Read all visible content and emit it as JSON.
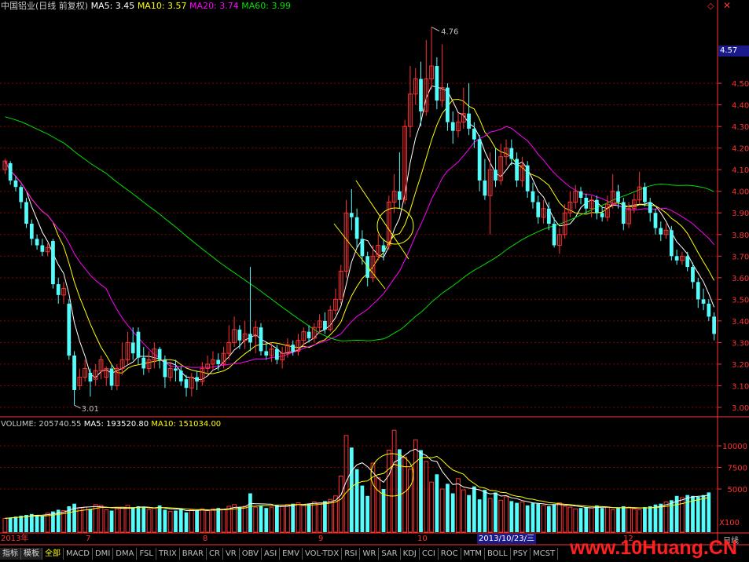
{
  "header": {
    "stock_name": "中国铝业(日线 前复权)",
    "ma5": "MA5: 3.45",
    "ma10": "MA10: 3.57",
    "ma20": "MA20: 3.74",
    "ma60": "MA60: 3.99"
  },
  "volume_header": {
    "volume": "VOLUME: 205740.55",
    "ma5": "MA5: 193520.80",
    "ma10": "MA10: 151034.00"
  },
  "colors": {
    "up": "#ff3232",
    "down": "#54fcfc",
    "ma5": "#ffffff",
    "ma10": "#ffff00",
    "ma20": "#ff00ff",
    "ma60": "#00e000",
    "axis": "#ff3232",
    "grid": "#8b0000"
  },
  "chart_data": {
    "type": "candlestick",
    "price_axis": {
      "ticks": [
        "4.50",
        "4.40",
        "4.30",
        "4.20",
        "4.10",
        "4.00",
        "3.90",
        "3.80",
        "3.70",
        "3.60",
        "3.50",
        "3.40",
        "3.30",
        "3.20",
        "3.10",
        "3.00"
      ],
      "ylim": [
        2.96,
        4.82
      ]
    },
    "current_price_label": "4.57",
    "annotations": {
      "high": "4.76",
      "low": "3.01"
    },
    "volume_axis": {
      "ticks": [
        "10000",
        "7500",
        "5000"
      ],
      "unit": "X100",
      "ylim": [
        0,
        13000
      ]
    },
    "x_labels": {
      "start": "2013年",
      "months": [
        "7",
        "8",
        "9",
        "10",
        "12"
      ],
      "cursor": "2013/10/23/三"
    },
    "candles": [
      {
        "o": 4.1,
        "c": 4.14,
        "h": 4.15,
        "l": 4.08
      },
      {
        "o": 4.13,
        "c": 4.05,
        "h": 4.14,
        "l": 4.03
      },
      {
        "o": 4.05,
        "c": 4.02,
        "h": 4.07,
        "l": 4.0
      },
      {
        "o": 4.02,
        "c": 3.95,
        "h": 4.03,
        "l": 3.92
      },
      {
        "o": 3.95,
        "c": 3.85,
        "h": 3.97,
        "l": 3.83
      },
      {
        "o": 3.85,
        "c": 3.78,
        "h": 3.87,
        "l": 3.75
      },
      {
        "o": 3.78,
        "c": 3.75,
        "h": 3.8,
        "l": 3.73
      },
      {
        "o": 3.75,
        "c": 3.72,
        "h": 3.78,
        "l": 3.7
      },
      {
        "o": 3.72,
        "c": 3.74,
        "h": 3.76,
        "l": 3.7
      },
      {
        "o": 3.77,
        "c": 3.57,
        "h": 3.78,
        "l": 3.55
      },
      {
        "o": 3.57,
        "c": 3.52,
        "h": 3.6,
        "l": 3.48
      },
      {
        "o": 3.52,
        "c": 3.55,
        "h": 3.58,
        "l": 3.48
      },
      {
        "o": 3.48,
        "c": 3.24,
        "h": 3.5,
        "l": 3.22
      },
      {
        "o": 3.24,
        "c": 3.08,
        "h": 3.26,
        "l": 3.01
      },
      {
        "o": 3.1,
        "c": 3.14,
        "h": 3.18,
        "l": 3.08
      },
      {
        "o": 3.14,
        "c": 3.18,
        "h": 3.22,
        "l": 3.12
      },
      {
        "o": 3.16,
        "c": 3.12,
        "h": 3.18,
        "l": 3.05
      },
      {
        "o": 3.13,
        "c": 3.17,
        "h": 3.2,
        "l": 3.1
      },
      {
        "o": 3.17,
        "c": 3.22,
        "h": 3.24,
        "l": 3.13
      },
      {
        "o": 3.14,
        "c": 3.18,
        "h": 3.19,
        "l": 3.1
      },
      {
        "o": 3.18,
        "c": 3.1,
        "h": 3.2,
        "l": 3.08
      },
      {
        "o": 3.1,
        "c": 3.18,
        "h": 3.2,
        "l": 3.08
      },
      {
        "o": 3.18,
        "c": 3.22,
        "h": 3.3,
        "l": 3.15
      },
      {
        "o": 3.22,
        "c": 3.3,
        "h": 3.35,
        "l": 3.2
      },
      {
        "o": 3.3,
        "c": 3.25,
        "h": 3.37,
        "l": 3.22
      },
      {
        "o": 3.35,
        "c": 3.23,
        "h": 3.37,
        "l": 3.2
      },
      {
        "o": 3.23,
        "c": 3.18,
        "h": 3.28,
        "l": 3.15
      },
      {
        "o": 3.18,
        "c": 3.22,
        "h": 3.26,
        "l": 3.16
      },
      {
        "o": 3.22,
        "c": 3.27,
        "h": 3.3,
        "l": 3.18
      },
      {
        "o": 3.27,
        "c": 3.22,
        "h": 3.28,
        "l": 3.18
      },
      {
        "o": 3.22,
        "c": 3.14,
        "h": 3.24,
        "l": 3.09
      },
      {
        "o": 3.14,
        "c": 3.18,
        "h": 3.21,
        "l": 3.12
      },
      {
        "o": 3.18,
        "c": 3.17,
        "h": 3.22,
        "l": 3.12
      },
      {
        "o": 3.17,
        "c": 3.12,
        "h": 3.19,
        "l": 3.1
      },
      {
        "o": 3.13,
        "c": 3.09,
        "h": 3.15,
        "l": 3.05
      },
      {
        "o": 3.09,
        "c": 3.14,
        "h": 3.16,
        "l": 3.05
      },
      {
        "o": 3.14,
        "c": 3.12,
        "h": 3.17,
        "l": 3.08
      },
      {
        "o": 3.12,
        "c": 3.18,
        "h": 3.21,
        "l": 3.1
      },
      {
        "o": 3.18,
        "c": 3.2,
        "h": 3.24,
        "l": 3.15
      },
      {
        "o": 3.2,
        "c": 3.22,
        "h": 3.26,
        "l": 3.17
      },
      {
        "o": 3.22,
        "c": 3.2,
        "h": 3.25,
        "l": 3.17
      },
      {
        "o": 3.2,
        "c": 3.25,
        "h": 3.28,
        "l": 3.18
      },
      {
        "o": 3.25,
        "c": 3.3,
        "h": 3.38,
        "l": 3.22
      },
      {
        "o": 3.3,
        "c": 3.36,
        "h": 3.42,
        "l": 3.28
      },
      {
        "o": 3.36,
        "c": 3.31,
        "h": 3.38,
        "l": 3.27
      },
      {
        "o": 3.31,
        "c": 3.34,
        "h": 3.4,
        "l": 3.27
      },
      {
        "o": 3.34,
        "c": 3.3,
        "h": 3.65,
        "l": 3.26
      },
      {
        "o": 3.33,
        "c": 3.37,
        "h": 3.4,
        "l": 3.25
      },
      {
        "o": 3.37,
        "c": 3.26,
        "h": 3.39,
        "l": 3.24
      },
      {
        "o": 3.26,
        "c": 3.24,
        "h": 3.3,
        "l": 3.22
      },
      {
        "o": 3.24,
        "c": 3.27,
        "h": 3.3,
        "l": 3.21
      },
      {
        "o": 3.27,
        "c": 3.22,
        "h": 3.29,
        "l": 3.2
      },
      {
        "o": 3.22,
        "c": 3.25,
        "h": 3.28,
        "l": 3.18
      },
      {
        "o": 3.25,
        "c": 3.29,
        "h": 3.32,
        "l": 3.23
      },
      {
        "o": 3.29,
        "c": 3.26,
        "h": 3.31,
        "l": 3.24
      },
      {
        "o": 3.26,
        "c": 3.31,
        "h": 3.34,
        "l": 3.24
      },
      {
        "o": 3.31,
        "c": 3.35,
        "h": 3.37,
        "l": 3.28
      },
      {
        "o": 3.35,
        "c": 3.32,
        "h": 3.38,
        "l": 3.3
      },
      {
        "o": 3.32,
        "c": 3.37,
        "h": 3.39,
        "l": 3.3
      },
      {
        "o": 3.37,
        "c": 3.4,
        "h": 3.43,
        "l": 3.34
      },
      {
        "o": 3.4,
        "c": 3.36,
        "h": 3.44,
        "l": 3.34
      },
      {
        "o": 3.36,
        "c": 3.45,
        "h": 3.47,
        "l": 3.35
      },
      {
        "o": 3.45,
        "c": 3.5,
        "h": 3.55,
        "l": 3.43
      },
      {
        "o": 3.5,
        "c": 3.63,
        "h": 3.66,
        "l": 3.48
      },
      {
        "o": 3.63,
        "c": 3.9,
        "h": 3.96,
        "l": 3.6
      },
      {
        "o": 3.9,
        "c": 3.88,
        "h": 4.01,
        "l": 3.82
      },
      {
        "o": 3.88,
        "c": 3.78,
        "h": 3.92,
        "l": 3.74
      },
      {
        "o": 3.78,
        "c": 3.7,
        "h": 3.82,
        "l": 3.66
      },
      {
        "o": 3.7,
        "c": 3.6,
        "h": 3.72,
        "l": 3.56
      },
      {
        "o": 3.6,
        "c": 3.7,
        "h": 3.75,
        "l": 3.58
      },
      {
        "o": 3.7,
        "c": 3.75,
        "h": 3.8,
        "l": 3.68
      },
      {
        "o": 3.75,
        "c": 3.72,
        "h": 3.78,
        "l": 3.68
      },
      {
        "o": 3.75,
        "c": 3.95,
        "h": 3.98,
        "l": 3.73
      },
      {
        "o": 3.95,
        "c": 4.0,
        "h": 4.08,
        "l": 3.9
      },
      {
        "o": 4.0,
        "c": 3.96,
        "h": 4.18,
        "l": 3.92
      },
      {
        "o": 3.96,
        "c": 4.3,
        "h": 4.33,
        "l": 3.94
      },
      {
        "o": 4.3,
        "c": 4.45,
        "h": 4.58,
        "l": 4.25
      },
      {
        "o": 4.45,
        "c": 4.52,
        "h": 4.57,
        "l": 4.4
      },
      {
        "o": 4.52,
        "c": 4.37,
        "h": 4.6,
        "l": 4.3
      },
      {
        "o": 4.37,
        "c": 4.52,
        "h": 4.7,
        "l": 4.35
      },
      {
        "o": 4.52,
        "c": 4.58,
        "h": 4.76,
        "l": 4.47
      },
      {
        "o": 4.58,
        "c": 4.42,
        "h": 4.62,
        "l": 4.38
      },
      {
        "o": 4.42,
        "c": 4.48,
        "h": 4.68,
        "l": 4.39
      },
      {
        "o": 4.48,
        "c": 4.32,
        "h": 4.5,
        "l": 4.28
      },
      {
        "o": 4.32,
        "c": 4.28,
        "h": 4.37,
        "l": 4.22
      },
      {
        "o": 4.28,
        "c": 4.32,
        "h": 4.36,
        "l": 4.25
      },
      {
        "o": 4.32,
        "c": 4.36,
        "h": 4.48,
        "l": 4.29
      },
      {
        "o": 4.36,
        "c": 4.29,
        "h": 4.5,
        "l": 4.26
      },
      {
        "o": 4.29,
        "c": 4.24,
        "h": 4.32,
        "l": 4.2
      },
      {
        "o": 4.24,
        "c": 4.05,
        "h": 4.26,
        "l": 4.0
      },
      {
        "o": 4.05,
        "c": 3.98,
        "h": 4.15,
        "l": 3.96
      },
      {
        "o": 3.98,
        "c": 4.1,
        "h": 4.18,
        "l": 3.8
      },
      {
        "o": 4.1,
        "c": 4.05,
        "h": 4.2,
        "l": 4.02
      },
      {
        "o": 4.05,
        "c": 4.16,
        "h": 4.22,
        "l": 4.03
      },
      {
        "o": 4.16,
        "c": 4.2,
        "h": 4.24,
        "l": 4.12
      },
      {
        "o": 4.2,
        "c": 4.15,
        "h": 4.24,
        "l": 4.12
      },
      {
        "o": 4.15,
        "c": 4.05,
        "h": 4.18,
        "l": 4.02
      },
      {
        "o": 4.05,
        "c": 4.12,
        "h": 4.16,
        "l": 4.02
      },
      {
        "o": 4.12,
        "c": 4.0,
        "h": 4.14,
        "l": 3.97
      },
      {
        "o": 4.0,
        "c": 3.95,
        "h": 4.04,
        "l": 3.92
      },
      {
        "o": 3.95,
        "c": 3.88,
        "h": 3.98,
        "l": 3.85
      },
      {
        "o": 3.88,
        "c": 3.92,
        "h": 3.96,
        "l": 3.85
      },
      {
        "o": 3.92,
        "c": 3.85,
        "h": 3.95,
        "l": 3.82
      },
      {
        "o": 3.85,
        "c": 3.75,
        "h": 3.88,
        "l": 3.74
      },
      {
        "o": 3.75,
        "c": 3.8,
        "h": 3.83,
        "l": 3.71
      },
      {
        "o": 3.8,
        "c": 3.9,
        "h": 3.94,
        "l": 3.78
      },
      {
        "o": 3.9,
        "c": 3.95,
        "h": 4.0,
        "l": 3.88
      },
      {
        "o": 3.95,
        "c": 4.0,
        "h": 4.03,
        "l": 3.92
      },
      {
        "o": 4.0,
        "c": 3.97,
        "h": 4.02,
        "l": 3.94
      },
      {
        "o": 3.97,
        "c": 3.92,
        "h": 3.99,
        "l": 3.9
      },
      {
        "o": 3.92,
        "c": 3.96,
        "h": 3.98,
        "l": 3.88
      },
      {
        "o": 3.96,
        "c": 3.9,
        "h": 3.98,
        "l": 3.87
      },
      {
        "o": 3.9,
        "c": 3.88,
        "h": 3.93,
        "l": 3.86
      },
      {
        "o": 3.88,
        "c": 3.94,
        "h": 3.98,
        "l": 3.86
      },
      {
        "o": 3.94,
        "c": 4.0,
        "h": 4.08,
        "l": 3.92
      },
      {
        "o": 4.0,
        "c": 3.95,
        "h": 4.03,
        "l": 3.92
      },
      {
        "o": 3.95,
        "c": 3.85,
        "h": 3.97,
        "l": 3.82
      },
      {
        "o": 3.85,
        "c": 3.92,
        "h": 3.95,
        "l": 3.83
      },
      {
        "o": 3.92,
        "c": 3.96,
        "h": 3.99,
        "l": 3.9
      },
      {
        "o": 3.96,
        "c": 4.02,
        "h": 4.09,
        "l": 3.94
      },
      {
        "o": 4.02,
        "c": 3.95,
        "h": 4.04,
        "l": 3.93
      },
      {
        "o": 3.95,
        "c": 3.9,
        "h": 3.97,
        "l": 3.86
      },
      {
        "o": 3.9,
        "c": 3.83,
        "h": 3.92,
        "l": 3.8
      },
      {
        "o": 3.83,
        "c": 3.8,
        "h": 3.86,
        "l": 3.77
      },
      {
        "o": 3.8,
        "c": 3.82,
        "h": 3.85,
        "l": 3.78
      },
      {
        "o": 3.82,
        "c": 3.7,
        "h": 3.84,
        "l": 3.68
      },
      {
        "o": 3.7,
        "c": 3.68,
        "h": 3.73,
        "l": 3.66
      },
      {
        "o": 3.68,
        "c": 3.7,
        "h": 3.72,
        "l": 3.66
      },
      {
        "o": 3.7,
        "c": 3.65,
        "h": 3.72,
        "l": 3.63
      },
      {
        "o": 3.65,
        "c": 3.58,
        "h": 3.67,
        "l": 3.55
      },
      {
        "o": 3.58,
        "c": 3.5,
        "h": 3.6,
        "l": 3.46
      },
      {
        "o": 3.5,
        "c": 3.48,
        "h": 3.55,
        "l": 3.45
      },
      {
        "o": 3.48,
        "c": 3.42,
        "h": 3.5,
        "l": 3.4
      },
      {
        "o": 3.42,
        "c": 3.34,
        "h": 3.44,
        "l": 3.31
      }
    ],
    "volumes": [
      1600,
      1700,
      1800,
      1900,
      2000,
      2100,
      2000,
      1900,
      2200,
      2400,
      2600,
      2500,
      3000,
      3300,
      2800,
      2900,
      2700,
      3200,
      3100,
      2600,
      2500,
      2700,
      2900,
      3100,
      2800,
      3000,
      2900,
      2600,
      2800,
      3100,
      2600,
      2400,
      2500,
      2700,
      2300,
      2600,
      2500,
      2700,
      2500,
      2700,
      2800,
      2600,
      3000,
      3200,
      2900,
      3000,
      4500,
      2900,
      3100,
      2800,
      2900,
      3100,
      3000,
      3200,
      3300,
      3400,
      3200,
      3300,
      3500,
      3400,
      3600,
      3800,
      4200,
      6500,
      11200,
      9800,
      7300,
      5400,
      4200,
      8000,
      6300,
      5000,
      9500,
      11800,
      9600,
      8700,
      7300,
      10700,
      9500,
      8200,
      5800,
      6700,
      5000,
      5600,
      4500,
      6200,
      4900,
      4300,
      5300,
      3800,
      4900,
      3900,
      4600,
      3700,
      4100,
      3600,
      3400,
      3500,
      3100,
      3400,
      3300,
      3100,
      3000,
      3200,
      3400,
      3000,
      2900,
      2700,
      2800,
      2900,
      2800,
      3100,
      2800,
      2900,
      2600,
      2800,
      3000,
      2900,
      2700,
      2600,
      2900,
      3000,
      3200,
      3300,
      3500,
      3700,
      4200,
      4000,
      4300,
      4200,
      4100,
      4300,
      4600
    ]
  },
  "bottom_tabs": {
    "side": [
      "指标",
      "模板"
    ],
    "items": [
      "全部",
      "MACD",
      "DMI",
      "DMA",
      "FSL",
      "TRIX",
      "BRAR",
      "CR",
      "VR",
      "OBV",
      "ASI",
      "EMV",
      "VOL-TDX",
      "RSI",
      "WR",
      "SAR",
      "KDJ",
      "CCI",
      "ROC",
      "MTM",
      "BOLL",
      "PSY",
      "MCST"
    ]
  },
  "right_corner": "日线",
  "watermark": "www.10Huang.CN"
}
